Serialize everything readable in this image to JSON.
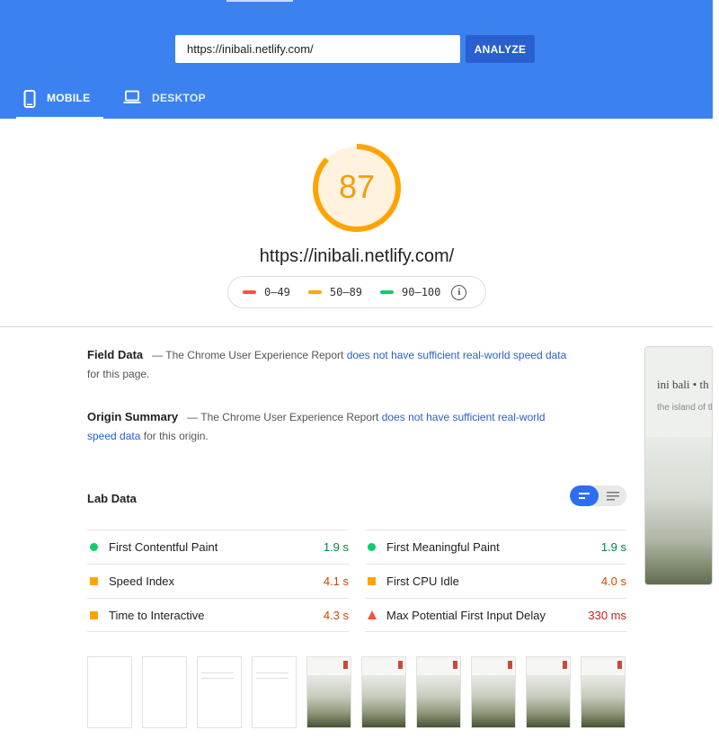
{
  "header": {
    "url_value": "https://inibali.netlify.com/",
    "analyze_label": "ANALYZE",
    "tabs": [
      {
        "label": "MOBILE",
        "icon": "smartphone-icon",
        "active": true
      },
      {
        "label": "DESKTOP",
        "icon": "laptop-icon",
        "active": false
      }
    ],
    "colors": {
      "background": "#3b82f0",
      "button": "#2a5fd0"
    }
  },
  "score": {
    "value": "87",
    "fraction": 0.87,
    "url": "https://inibali.netlify.com/",
    "color": "#ffa400"
  },
  "legend": {
    "items": [
      {
        "label": "0–49",
        "color": "#ff4e42"
      },
      {
        "label": "50–89",
        "color": "#ffa400"
      },
      {
        "label": "90–100",
        "color": "#0cce6b"
      }
    ],
    "info_icon": "info-icon"
  },
  "field_data": {
    "label": "Field Data",
    "dash": "—",
    "text_before": "The Chrome User Experience Report",
    "link": "does not have sufficient real-world speed data",
    "text_after": "for this page."
  },
  "origin_summary": {
    "label": "Origin Summary",
    "dash": "—",
    "text_before": "The Chrome User Experience Report",
    "link": "does not have sufficient real-world speed data",
    "text_after": "for this origin."
  },
  "lab_data": {
    "title": "Lab Data",
    "toggle": {
      "left_icon": "compact-view-icon",
      "right_icon": "list-view-icon"
    },
    "metrics": [
      {
        "name": "First Contentful Paint",
        "value": "1.9 s",
        "status": "pass"
      },
      {
        "name": "First Meaningful Paint",
        "value": "1.9 s",
        "status": "pass"
      },
      {
        "name": "Speed Index",
        "value": "4.1 s",
        "status": "average"
      },
      {
        "name": "First CPU Idle",
        "value": "4.0 s",
        "status": "average"
      },
      {
        "name": "Time to Interactive",
        "value": "4.3 s",
        "status": "average"
      },
      {
        "name": "Max Potential First Input Delay",
        "value": "330 ms",
        "status": "fail"
      }
    ]
  },
  "preview": {
    "site_title": "ini bali • th",
    "tagline": "the island of th gods"
  },
  "filmstrip": {
    "frame_count": 10,
    "frames": [
      "blank",
      "blank",
      "text",
      "text",
      "image",
      "image",
      "image",
      "image",
      "image",
      "image"
    ]
  }
}
